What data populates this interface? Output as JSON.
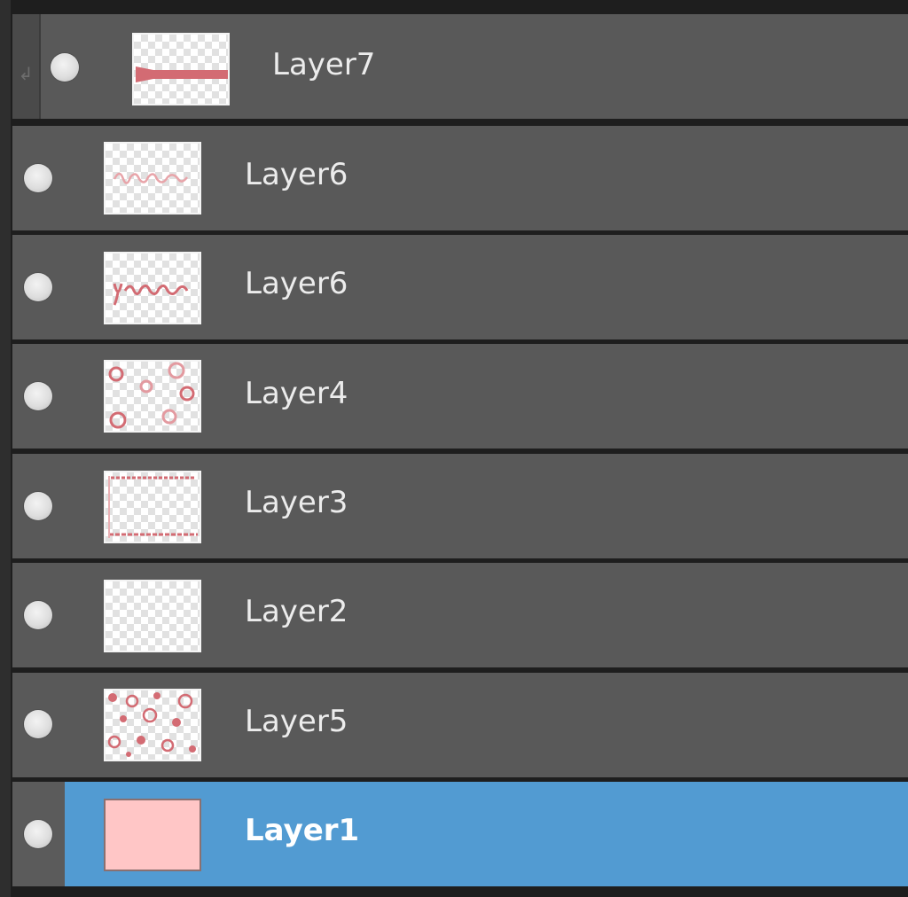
{
  "layers_panel": {
    "layers": [
      {
        "name": "Layer7",
        "thumbnail": "ribbon-strip",
        "visible": true,
        "clipped": true,
        "selected": false
      },
      {
        "name": "Layer6",
        "thumbnail": "script-text-light",
        "visible": true,
        "clipped": false,
        "selected": false
      },
      {
        "name": "Layer6",
        "thumbnail": "script-text",
        "visible": true,
        "clipped": false,
        "selected": false
      },
      {
        "name": "Layer4",
        "thumbnail": "flower-corners",
        "visible": true,
        "clipped": false,
        "selected": false
      },
      {
        "name": "Layer3",
        "thumbnail": "border-lines",
        "visible": true,
        "clipped": false,
        "selected": false
      },
      {
        "name": "Layer2",
        "thumbnail": "empty-transparent",
        "visible": true,
        "clipped": false,
        "selected": false
      },
      {
        "name": "Layer5",
        "thumbnail": "dot-pattern",
        "visible": true,
        "clipped": false,
        "selected": false
      },
      {
        "name": "Layer1",
        "thumbnail": "solid-pink-fill",
        "visible": true,
        "clipped": false,
        "selected": true
      }
    ]
  },
  "colors": {
    "row_background": "#595959",
    "selection": "#529bd2",
    "thumbnail_art": "#d36b73",
    "layer1_fill": "#ffc6c6"
  },
  "icons": {
    "visibility": "eye-dot-icon",
    "clipping": "clipping-arrow-icon"
  }
}
